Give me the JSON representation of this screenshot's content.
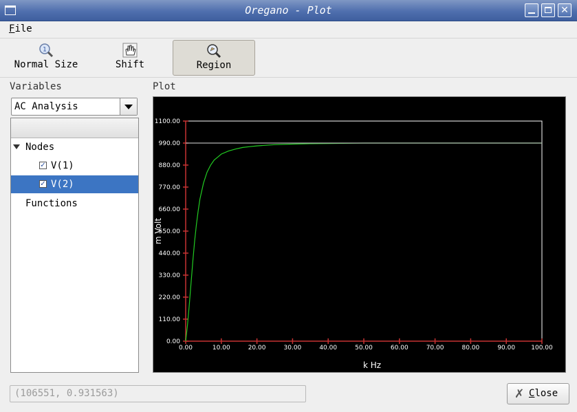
{
  "window": {
    "title": "Oregano - Plot"
  },
  "menu": {
    "file": {
      "mnemonic": "F",
      "rest": "ile"
    }
  },
  "toolbar": {
    "normal_size": "Normal Size",
    "shift": "Shift",
    "region": "Region"
  },
  "variables": {
    "label": "Variables",
    "analysis": "AC Analysis",
    "nodes_label": "Nodes",
    "v1": "V(1)",
    "v2": "V(2)",
    "functions_label": "Functions"
  },
  "plot": {
    "label": "Plot",
    "colors": {
      "background": "#000000",
      "frame": "#ffffff",
      "axis": "#c83232",
      "trace": "#22cc22",
      "reference": "#b4b4b4"
    }
  },
  "chart_data": {
    "type": "line",
    "xlabel": "k Hz",
    "ylabel": "m Volt",
    "xlim": [
      0,
      100
    ],
    "ylim": [
      0,
      1100
    ],
    "xticks": [
      "0.00",
      "10.00",
      "20.00",
      "30.00",
      "40.00",
      "50.00",
      "60.00",
      "70.00",
      "80.00",
      "90.00",
      "100.00"
    ],
    "yticks": [
      "0.00",
      "110.00",
      "220.00",
      "330.00",
      "440.00",
      "550.00",
      "660.00",
      "770.00",
      "880.00",
      "990.00",
      "1100.00"
    ],
    "series": [
      {
        "color": "#22cc22",
        "x": [
          0,
          0.5,
          1,
          1.5,
          2,
          2.5,
          3,
          3.5,
          4,
          5,
          6,
          7,
          8,
          9,
          10,
          12,
          14,
          16,
          18,
          20,
          25,
          30,
          35,
          40,
          50,
          60,
          70,
          80,
          90,
          100
        ],
        "y": [
          0,
          80,
          180,
          290,
          400,
          500,
          580,
          650,
          710,
          790,
          845,
          880,
          905,
          920,
          935,
          950,
          960,
          968,
          972,
          976,
          982,
          985,
          987,
          988,
          990,
          990,
          990,
          990,
          990,
          990
        ]
      },
      {
        "color": "#b4b4b4",
        "x": [
          0,
          100
        ],
        "y": [
          990,
          990
        ]
      }
    ]
  },
  "status": {
    "coords": "(106551, 0.931563)"
  },
  "buttons": {
    "close": {
      "mnemonic": "C",
      "rest": "lose"
    }
  }
}
